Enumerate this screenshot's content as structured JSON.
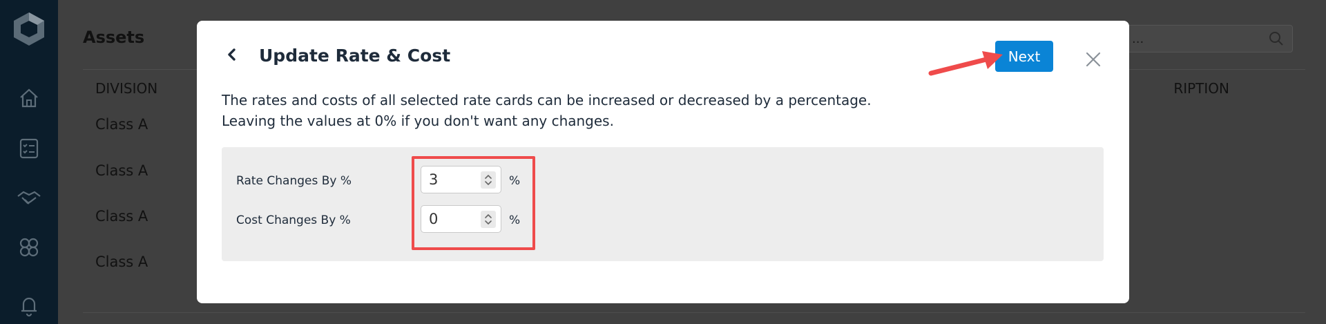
{
  "app": {
    "page_title": "Assets",
    "search_placeholder": "rch ...",
    "table": {
      "col_left": "DIVISION",
      "col_right": "RIPTION",
      "rows": [
        "Class A",
        "Class A",
        "Class A",
        "Class A"
      ]
    },
    "sidebar_icons": [
      "home-icon",
      "checklist-icon",
      "handshake-icon",
      "apps-icon",
      "bell-icon"
    ]
  },
  "modal": {
    "title": "Update Rate & Cost",
    "next_label": "Next",
    "description_line1": "The rates and costs of all selected rate cards can be increased or decreased by a percentage.",
    "description_line2": "Leaving the values at 0% if you don't want any changes.",
    "fields": [
      {
        "label": "Rate Changes By %",
        "value": "3",
        "unit": "%"
      },
      {
        "label": "Cost Changes By %",
        "value": "0",
        "unit": "%"
      }
    ]
  },
  "colors": {
    "accent": "#0a84d6",
    "annotation": "#ef4b4b",
    "sidebar": "#0b1d2b"
  }
}
